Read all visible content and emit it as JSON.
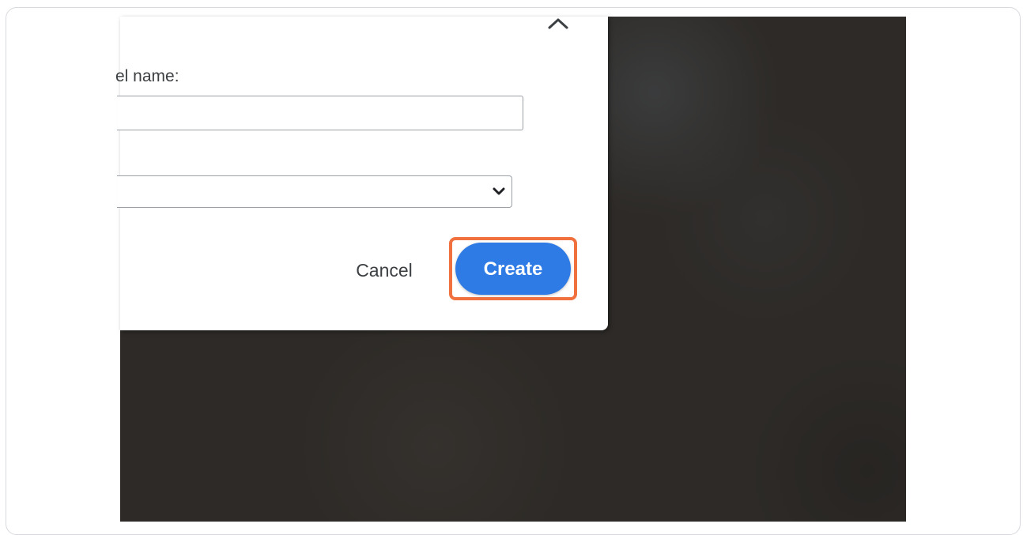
{
  "dialog": {
    "name_label": "el name:",
    "name_input_value": "",
    "select_value": "",
    "cancel_label": "Cancel",
    "create_label": "Create"
  },
  "icons": {
    "collapse": "chevron-up-icon",
    "dropdown": "chevron-down-icon"
  },
  "colors": {
    "primary_button": "#2f7be5",
    "highlight_outline": "#f0703e",
    "backdrop": "#2d2a27"
  }
}
